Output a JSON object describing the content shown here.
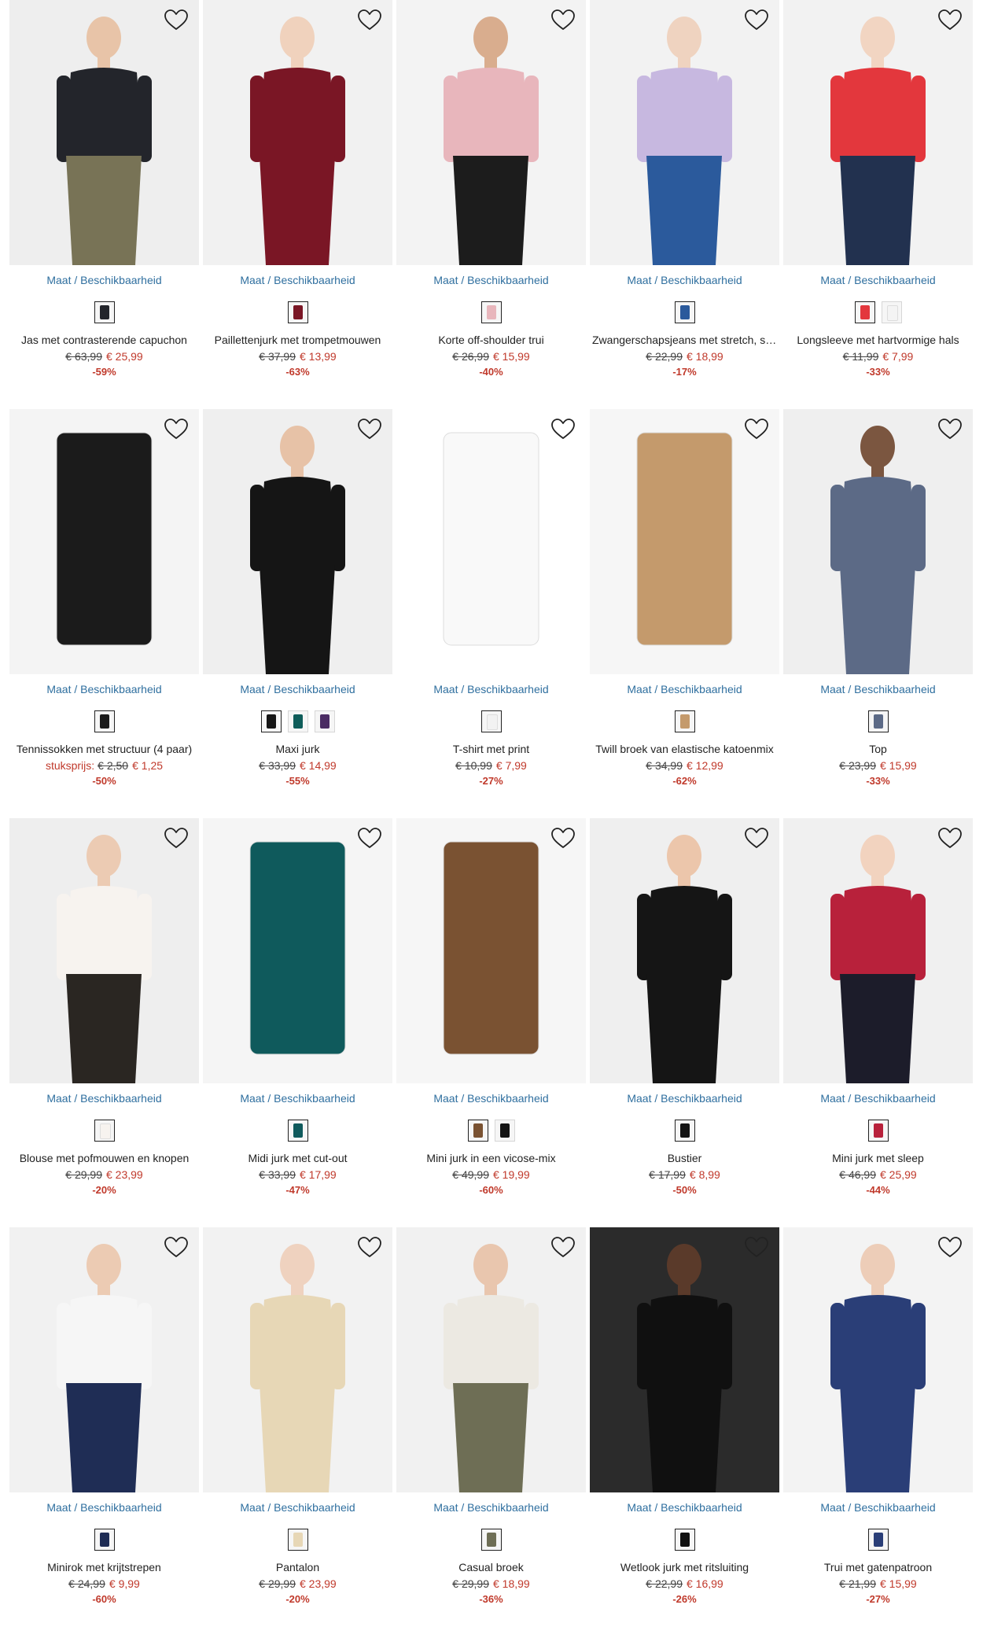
{
  "size_link_label": "Maat / Beschikbaarheid",
  "currency": "€",
  "products": [
    {
      "name": "Jas met contrasterende capuchon",
      "old": "€ 63,99",
      "new": "€ 25,99",
      "discount": "-59%",
      "bg": "#eeeeee",
      "garment": "#23252b",
      "skin": "#e8c4a8",
      "lower": "#787356",
      "swatches": [
        "#23252b"
      ]
    },
    {
      "name": "Paillettenjurk met trompetmouwen",
      "old": "€ 37,99",
      "new": "€ 13,99",
      "discount": "-63%",
      "bg": "#f1f1f1",
      "garment": "#7a1625",
      "skin": "#f0d2bd",
      "lower": "#7a1625",
      "swatches": [
        "#7a1625"
      ]
    },
    {
      "name": "Korte off-shoulder trui",
      "old": "€ 26,99",
      "new": "€ 15,99",
      "discount": "-40%",
      "bg": "#f3f3f3",
      "garment": "#e8b6bc",
      "skin": "#d9ad8e",
      "lower": "#1c1c1c",
      "swatches": [
        "#e8b6bc"
      ]
    },
    {
      "name": "Zwangerschapsjeans met stretch, straight",
      "old": "€ 22,99",
      "new": "€ 18,99",
      "discount": "-17%",
      "bg": "#f2f2f2",
      "garment": "#c7b8e0",
      "skin": "#efd3c0",
      "lower": "#2b5a9c",
      "swatches": [
        "#2b5a9c"
      ]
    },
    {
      "name": "Longsleeve met hartvormige hals",
      "old": "€ 11,99",
      "new": "€ 7,99",
      "discount": "-33%",
      "bg": "#f2f2f2",
      "garment": "#e3373d",
      "skin": "#f2d5c2",
      "lower": "#22314f",
      "swatches": [
        "#e3373d",
        "#f4f4f4"
      ]
    },
    {
      "name": "Tennissokken met structuur (4 paar)",
      "unit": "stuksprijs:",
      "old": "€ 2,50",
      "new": "€ 1,25",
      "discount": "-50%",
      "bg": "#f4f4f4",
      "garment": "#1b1b1b",
      "skin": "#ffffff",
      "lower": "#ffffff",
      "swatches": [
        "#1b1b1b"
      ]
    },
    {
      "name": "Maxi jurk",
      "old": "€ 33,99",
      "new": "€ 14,99",
      "discount": "-55%",
      "bg": "#efefef",
      "garment": "#151515",
      "skin": "#e7c2a7",
      "lower": "#151515",
      "swatches": [
        "#151515",
        "#0f5d5a",
        "#4b2c63"
      ]
    },
    {
      "name": "T-shirt met print",
      "old": "€ 10,99",
      "new": "€ 7,99",
      "discount": "-27%",
      "bg": "#ffffff",
      "garment": "#f9f9f9",
      "skin": "#ffffff",
      "lower": "#ffffff",
      "swatches": [
        "#f2f2f2"
      ]
    },
    {
      "name": "Twill broek van elastische katoenmix",
      "old": "€ 34,99",
      "new": "€ 12,99",
      "discount": "-62%",
      "bg": "#f6f6f6",
      "garment": "#c49a6c",
      "skin": "#ffffff",
      "lower": "#c49a6c",
      "swatches": [
        "#c49a6c"
      ]
    },
    {
      "name": "Top",
      "old": "€ 23,99",
      "new": "€ 15,99",
      "discount": "-33%",
      "bg": "#efefef",
      "garment": "#5c6a86",
      "skin": "#7b5640",
      "lower": "#5c6a86",
      "swatches": [
        "#5c6a86"
      ]
    },
    {
      "name": "Blouse met pofmouwen en knopen",
      "old": "€ 29,99",
      "new": "€ 23,99",
      "discount": "-20%",
      "bg": "#eeeeee",
      "garment": "#f7f3ef",
      "skin": "#eccbb3",
      "lower": "#2a2622",
      "swatches": [
        "#f7f3ef"
      ]
    },
    {
      "name": "Midi jurk met cut-out",
      "old": "€ 33,99",
      "new": "€ 17,99",
      "discount": "-47%",
      "bg": "#f5f5f5",
      "garment": "#0f5a5c",
      "skin": "#ffffff",
      "lower": "#0f5a5c",
      "swatches": [
        "#0f5a5c"
      ]
    },
    {
      "name": "Mini jurk in een vicose-mix",
      "old": "€ 49,99",
      "new": "€ 19,99",
      "discount": "-60%",
      "bg": "#f6f6f6",
      "garment": "#7a5232",
      "skin": "#ffffff",
      "lower": "#7a5232",
      "swatches": [
        "#7a5232",
        "#141414"
      ]
    },
    {
      "name": "Bustier",
      "old": "€ 17,99",
      "new": "€ 8,99",
      "discount": "-50%",
      "bg": "#efefef",
      "garment": "#151515",
      "skin": "#ecc6ab",
      "lower": "#151515",
      "swatches": [
        "#151515"
      ]
    },
    {
      "name": "Mini jurk met sleep",
      "old": "€ 46,99",
      "new": "€ 25,99",
      "discount": "-44%",
      "bg": "#f0f0f0",
      "garment": "#b8213b",
      "skin": "#f2d3bf",
      "lower": "#1c1c2a",
      "swatches": [
        "#b8213b"
      ]
    },
    {
      "name": "Minirok met krijtstrepen",
      "old": "€ 24,99",
      "new": "€ 9,99",
      "discount": "-60%",
      "bg": "#f1f1f1",
      "garment": "#f6f6f6",
      "skin": "#eccbb3",
      "lower": "#1f2d55",
      "swatches": [
        "#1f2d55"
      ]
    },
    {
      "name": "Pantalon",
      "old": "€ 29,99",
      "new": "€ 23,99",
      "discount": "-20%",
      "bg": "#f2f2f2",
      "garment": "#e7d7b6",
      "skin": "#efd2bf",
      "lower": "#e7d7b6",
      "swatches": [
        "#e7d7b6"
      ]
    },
    {
      "name": "Casual broek",
      "old": "€ 29,99",
      "new": "€ 18,99",
      "discount": "-36%",
      "bg": "#f1f1f1",
      "garment": "#ece9e2",
      "skin": "#e9c6ae",
      "lower": "#6e6e55",
      "swatches": [
        "#6e6e55"
      ]
    },
    {
      "name": "Wetlook jurk met ritsluiting",
      "old": "€ 22,99",
      "new": "€ 16,99",
      "discount": "-26%",
      "bg": "#2b2b2b",
      "garment": "#101010",
      "skin": "#5a3a2a",
      "lower": "#101010",
      "swatches": [
        "#101010"
      ]
    },
    {
      "name": "Trui met gatenpatroon",
      "old": "€ 21,99",
      "new": "€ 15,99",
      "discount": "-27%",
      "bg": "#f3f3f3",
      "garment": "#2a3e77",
      "skin": "#edcdb8",
      "lower": "#2a3e77",
      "swatches": [
        "#2a3e77"
      ]
    }
  ]
}
